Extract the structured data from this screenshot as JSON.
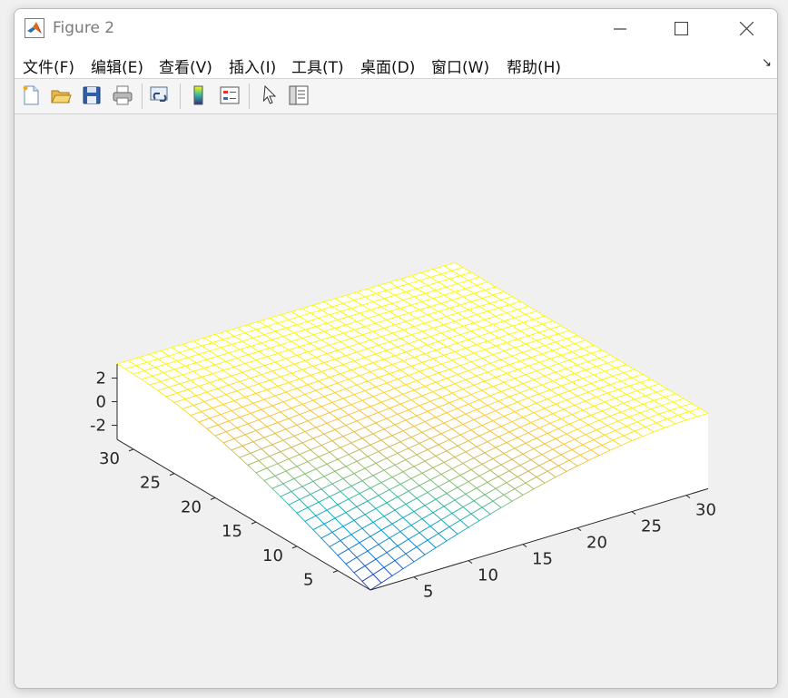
{
  "window": {
    "title": "Figure 2",
    "app_icon": "matlab-logo-icon"
  },
  "menu": {
    "items": [
      "文件(F)",
      "编辑(E)",
      "查看(V)",
      "插入(I)",
      "工具(T)",
      "桌面(D)",
      "窗口(W)",
      "帮助(H)"
    ],
    "overflow_icon": "dock-arrow-icon"
  },
  "toolbar": {
    "buttons": [
      "new-figure-icon",
      "open-file-icon",
      "save-icon",
      "print-icon",
      "link-plot-icon",
      "insert-colorbar-icon",
      "insert-legend-icon",
      "edit-plot-pointer-icon",
      "property-inspector-icon"
    ]
  },
  "chart_data": {
    "type": "surface-mesh",
    "title": "",
    "xlabel": "",
    "ylabel": "",
    "zlabel": "",
    "x_ticks": [
      5,
      10,
      15,
      20,
      25,
      30
    ],
    "y_ticks": [
      5,
      10,
      15,
      20,
      25,
      30
    ],
    "z_ticks": [
      -2,
      0,
      2
    ],
    "xlim": [
      1,
      32
    ],
    "ylim": [
      1,
      32
    ],
    "zlim": [
      -3.2,
      3.2
    ],
    "grid_size": 32,
    "colormap": "parula",
    "colormap_stops": [
      "#352a87",
      "#0f5cdd",
      "#1481d6",
      "#06a4ca",
      "#2eb7a4",
      "#87bf77",
      "#d1bb59",
      "#fec832",
      "#f9fb0e"
    ],
    "view": {
      "azimuth": -37.5,
      "elevation": 30
    },
    "wireframe": true,
    "surface_description_values": {
      "z_at_corner_low_x_low_y": -3.2,
      "z_at_far_edge": 3.2
    }
  }
}
